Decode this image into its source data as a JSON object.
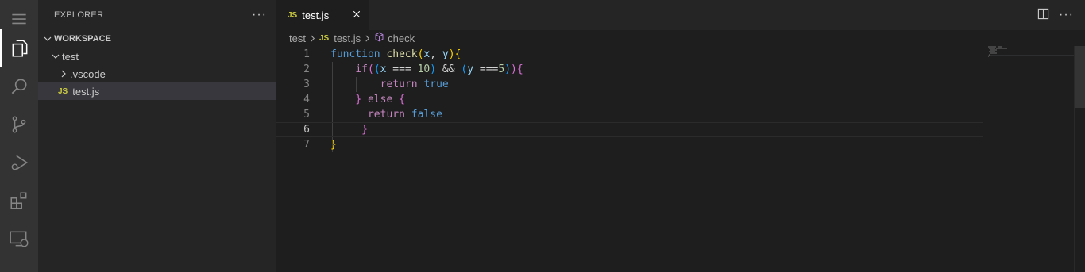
{
  "sidebar": {
    "title": "EXPLORER",
    "more": "···",
    "workspace": "WORKSPACE",
    "folder": "test",
    "subfolder": ".vscode",
    "file_badge": "JS",
    "file": "test.js"
  },
  "tabs": [
    {
      "badge": "JS",
      "label": "test.js",
      "close": "✕"
    }
  ],
  "tab_actions": {
    "more": "···"
  },
  "breadcrumb": {
    "folder": "test",
    "file_badge": "JS",
    "file": "test.js",
    "symbol": "check"
  },
  "editor": {
    "line_numbers": [
      "1",
      "2",
      "3",
      "4",
      "5",
      "6",
      "7"
    ],
    "current_line": "6",
    "lines": [
      "function check(x, y){",
      "    if((x === 10) && (y ===5)){",
      "        return true",
      "    } else {",
      "      return false",
      "     }",
      "}"
    ]
  },
  "colors": {
    "keyword_blue": "#569cd6",
    "keyword_pink": "#c586c0",
    "function": "#dcdcaa",
    "variable": "#9cdcfe",
    "number": "#b5cea8",
    "js_badge": "#cbcb41"
  },
  "icons": {
    "activity": [
      "explorer-icon",
      "search-icon",
      "source-control-icon",
      "run-debug-icon",
      "extensions-icon",
      "remote-explorer-icon"
    ]
  }
}
